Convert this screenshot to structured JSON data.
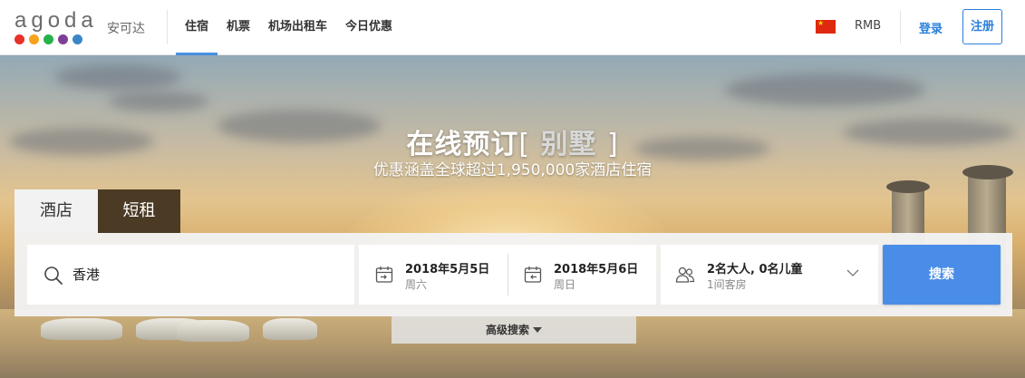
{
  "brand": {
    "wordmark": "agoda",
    "name_cn": "安可达",
    "dot_colors": [
      "#e8312a",
      "#f7a21b",
      "#27b14a",
      "#7e3f98",
      "#3a86c8"
    ]
  },
  "nav": {
    "items": [
      {
        "label": "住宿",
        "active": true
      },
      {
        "label": "机票",
        "active": false
      },
      {
        "label": "机场出租车",
        "active": false
      },
      {
        "label": "今日优惠",
        "active": false
      }
    ],
    "currency": "RMB",
    "login": "登录",
    "register": "注册",
    "flag_icon": "china-flag-icon"
  },
  "hero": {
    "title": "在线预订",
    "keyword": "别墅",
    "bracket_open": "[",
    "bracket_close": "]",
    "subtitle": "优惠涵盖全球超过1,950,000家酒店住宿"
  },
  "tabs": [
    {
      "label": "酒店",
      "active": true
    },
    {
      "label": "短租",
      "active": false
    }
  ],
  "search": {
    "destination": "香港",
    "checkin": {
      "date": "2018年5月5日",
      "weekday": "周六"
    },
    "checkout": {
      "date": "2018年5月6日",
      "weekday": "周日"
    },
    "guests": {
      "summary": "2名大人, 0名儿童",
      "rooms": "1间客房"
    },
    "button": "搜索",
    "advanced": "高级搜索"
  },
  "colors": {
    "accent": "#4a8de8",
    "link": "#2a7fdb",
    "rent_tab": "#4b3a24"
  }
}
